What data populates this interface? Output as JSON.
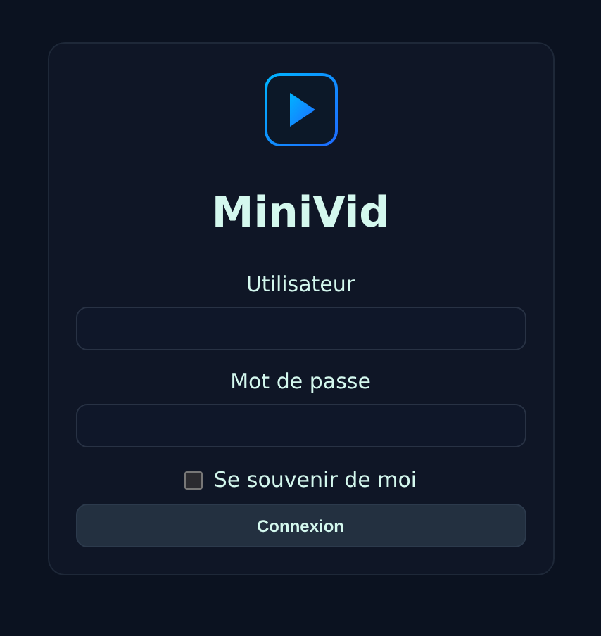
{
  "app": {
    "title": "MiniVid"
  },
  "fields": [
    {
      "label": "Utilisateur"
    },
    {
      "label": "Mot de passe"
    }
  ],
  "remember": {
    "label": "Se souvenir de moi",
    "checked": false
  },
  "submit": {
    "label": "Connexion"
  }
}
